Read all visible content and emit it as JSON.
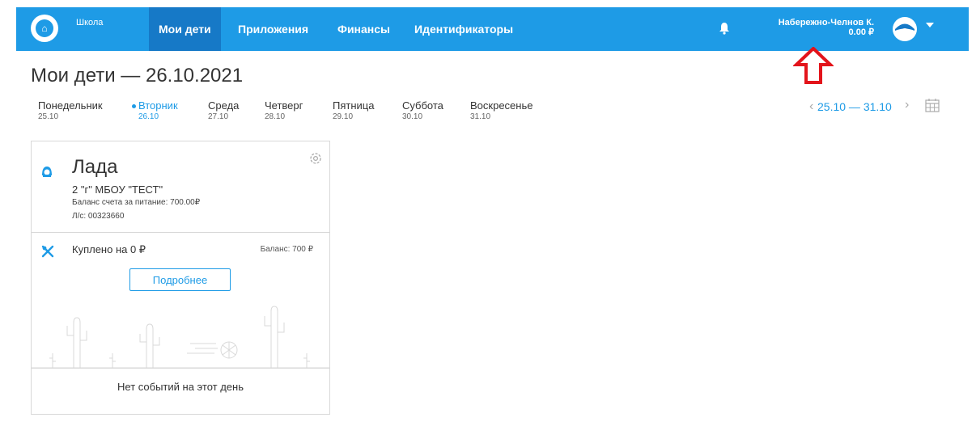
{
  "header": {
    "brand": "Школа",
    "nav": [
      {
        "label": "Мои дети"
      },
      {
        "label": "Приложения"
      },
      {
        "label": "Финансы"
      },
      {
        "label": "Идентификаторы"
      }
    ],
    "user_name": "Набережно-Челнов К.",
    "user_balance": "0.00 ₽",
    "accent_color": "#1e9be6",
    "active_nav_color": "#1679c7",
    "annotation_arrow_color": "#e3141b"
  },
  "page": {
    "title": "Мои дети — 26.10.2021"
  },
  "week": {
    "days": [
      {
        "name": "Понедельник",
        "date": "25.10"
      },
      {
        "name": "Вторник",
        "date": "26.10"
      },
      {
        "name": "Среда",
        "date": "27.10"
      },
      {
        "name": "Четверг",
        "date": "28.10"
      },
      {
        "name": "Пятница",
        "date": "29.10"
      },
      {
        "name": "Суббота",
        "date": "30.10"
      },
      {
        "name": "Воскресенье",
        "date": "31.10"
      }
    ],
    "range": "25.10 — 31.10",
    "prev": "‹",
    "next": "›"
  },
  "card": {
    "child_name": "Лада",
    "school": "2 \"г\" МБОУ \"ТЕСТ\"",
    "food_balance": "Баланс счета за питание: 700.00₽",
    "account": "Л/с: 00323660",
    "bought": "Куплено на 0 ₽",
    "balance": "Баланс: 700 ₽",
    "more_button": "Подробнее",
    "no_events": "Нет событий на этот день"
  }
}
